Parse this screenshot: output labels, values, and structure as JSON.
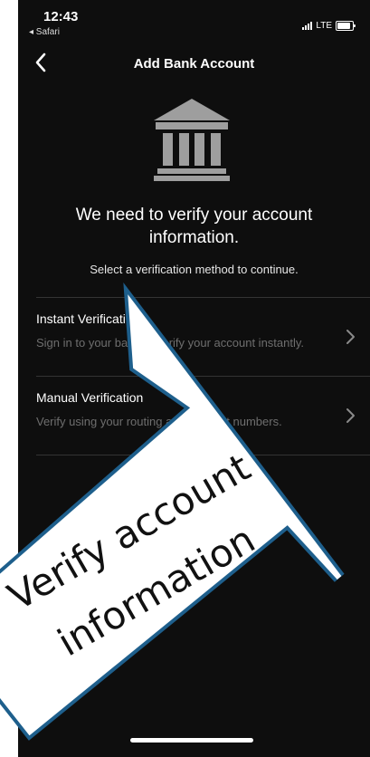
{
  "status_bar": {
    "time": "12:43",
    "back_app": "◂ Safari",
    "network": "LTE"
  },
  "nav": {
    "title": "Add Bank Account",
    "back_icon": "chevron-left-icon"
  },
  "content": {
    "icon": "bank-icon",
    "headline": "We need to verify your account information.",
    "subline": "Select a verification method to continue."
  },
  "options": [
    {
      "title": "Instant Verification",
      "description": "Sign in to your bank to verify your account instantly."
    },
    {
      "title": "Manual Verification",
      "description": "Verify using your routing and account numbers."
    }
  ],
  "callout": {
    "line1": "Verify account",
    "line2": "information",
    "fill_color": "#ffffff",
    "border_color": "#1e5f8c"
  }
}
